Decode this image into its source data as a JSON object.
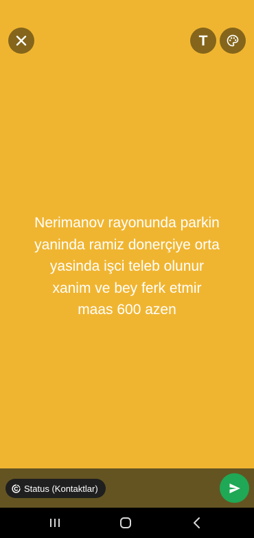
{
  "theme": {
    "background": "#f0b530",
    "bottom_bar": "#645422",
    "send_button": "#1fa855",
    "text_color": "#ffffff"
  },
  "toolbar": {
    "close_icon": "close-icon",
    "text_tool_label": "T",
    "palette_icon": "palette-icon"
  },
  "status": {
    "lines": [
      "Nerimanov  rayonunda parkin",
      "yaninda ramiz donerçiye orta",
      "yasinda işci teleb olunur",
      "xanim ve bey ferk etmir",
      "maas 600 azen"
    ]
  },
  "composer": {
    "audience_label": "Status (Kontaktlar)",
    "audience_icon": "status-icon",
    "send_icon": "send-icon"
  },
  "navigation": {
    "recents_icon": "recents-icon",
    "home_icon": "home-icon",
    "back_icon": "back-icon"
  }
}
